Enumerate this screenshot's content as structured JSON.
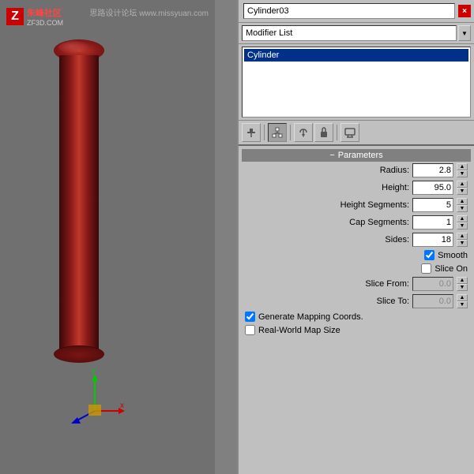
{
  "watermark": {
    "text": "思路设计论坛 www.missyuan.com"
  },
  "logo": {
    "z": "Z",
    "site": "朱峰社区",
    "sub": "ZF3D.COM"
  },
  "panel": {
    "title": "Cylinder03",
    "close_btn": "×",
    "modifier_list_label": "Modifier List",
    "stack_item": "Cylinder",
    "params_header": "Parameters",
    "params_collapse": "−",
    "radius_label": "Radius:",
    "radius_value": "2.8",
    "height_label": "Height:",
    "height_value": "95.0",
    "height_segs_label": "Height Segments:",
    "height_segs_value": "5",
    "cap_segs_label": "Cap Segments:",
    "cap_segs_value": "1",
    "sides_label": "Sides:",
    "sides_value": "18",
    "smooth_label": "Smooth",
    "smooth_checked": true,
    "slice_on_label": "Slice On",
    "slice_on_checked": false,
    "slice_from_label": "Slice From:",
    "slice_from_value": "0.0",
    "slice_to_label": "Slice To:",
    "slice_to_value": "0.0",
    "generate_label": "Generate Mapping Coords.",
    "generate_checked": true,
    "realworld_label": "Real-World Map Size",
    "realworld_checked": false
  },
  "toolbar": {
    "btn1": "📌",
    "btn2": "1",
    "btn3": "⚡",
    "btn4": "🔒",
    "btn5": "📋"
  }
}
